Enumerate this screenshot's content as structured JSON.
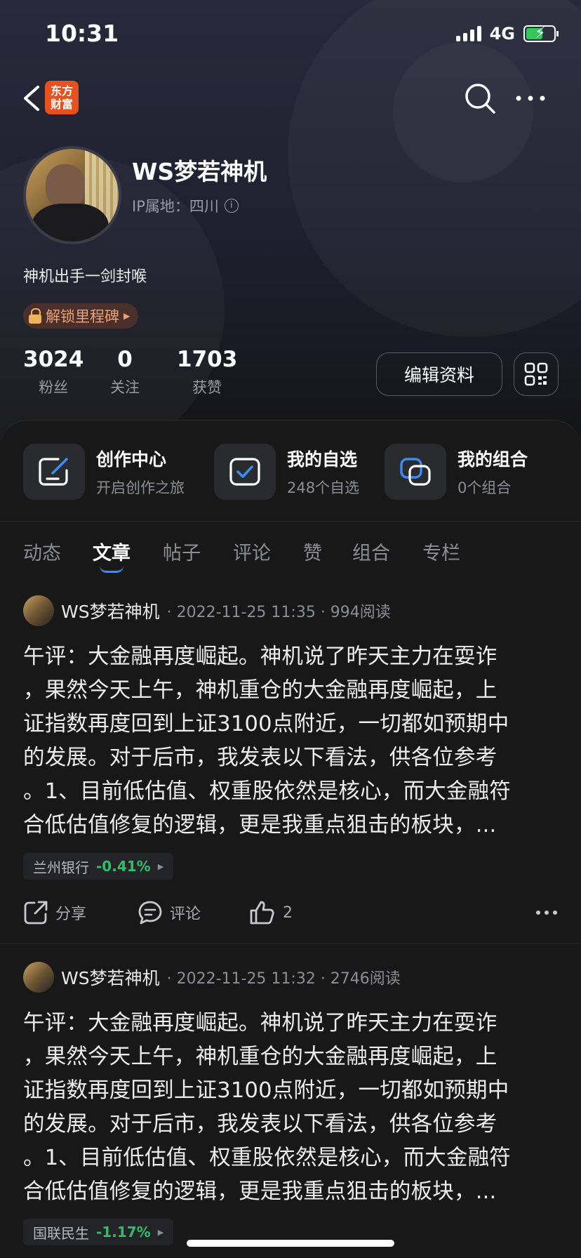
{
  "status_bar": {
    "time": "10:31",
    "network": "4G"
  },
  "nav": {
    "logo_text": "东方财富"
  },
  "profile": {
    "username": "WS梦若神机",
    "ip_label": "IP属地：四川",
    "bio": "神机出手一剑封喉",
    "milestone": "解锁里程碑",
    "stats": [
      {
        "value": "3024",
        "label": "粉丝"
      },
      {
        "value": "0",
        "label": "关注"
      },
      {
        "value": "1703",
        "label": "获赞"
      }
    ],
    "edit_button": "编辑资料"
  },
  "features": [
    {
      "title": "创作中心",
      "subtitle": "开启创作之旅",
      "icon": "pen-icon"
    },
    {
      "title": "我的自选",
      "subtitle": "248个自选",
      "icon": "checkbox-icon"
    },
    {
      "title": "我的组合",
      "subtitle": "0个组合",
      "icon": "overlap-icon"
    }
  ],
  "tabs": [
    "动态",
    "文章",
    "帖子",
    "评论",
    "赞",
    "组合",
    "专栏"
  ],
  "active_tab": "文章",
  "posts": [
    {
      "author": "WS梦若神机",
      "meta": "· 2022-11-25 11:35 · 994阅读",
      "lines": [
        "午评：大金融再度崛起。神机说了昨天主力在耍诈",
        "，果然今天上午，神机重仓的大金融再度崛起，上",
        "证指数再度回到上证3100点附近，一切都如预期中",
        "的发展。对于后市，我发表以下看法，供各位参考",
        "。1、目前低估值、权重股依然是核心，而大金融符",
        "合低估值修复的逻辑，更是我重点狙击的板块，..."
      ],
      "stock": {
        "name": "兰州银行",
        "change": "-0.41%"
      },
      "share": "分享",
      "comment": "评论",
      "likes": "2"
    },
    {
      "author": "WS梦若神机",
      "meta": "· 2022-11-25 11:32 · 2746阅读",
      "lines": [
        "午评：大金融再度崛起。神机说了昨天主力在耍诈",
        "，果然今天上午，神机重仓的大金融再度崛起，上",
        "证指数再度回到上证3100点附近，一切都如预期中",
        "的发展。对于后市，我发表以下看法，供各位参考",
        "。1、目前低估值、权重股依然是核心，而大金融符",
        "合低估值修复的逻辑，更是我重点狙击的板块，..."
      ],
      "stock": {
        "name": "国联民生",
        "change": "-1.17%"
      }
    }
  ],
  "colors": {
    "accent": "#3c8cf5",
    "down": "#2fbf6a",
    "brand": "#e8501e",
    "milestone": "#e8a27a"
  }
}
